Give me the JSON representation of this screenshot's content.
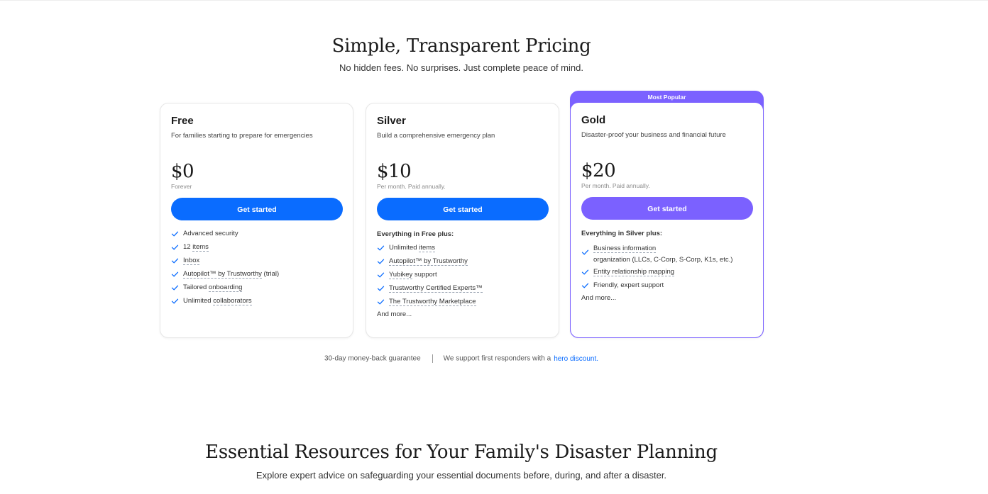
{
  "pricing": {
    "title": "Simple, Transparent Pricing",
    "subtitle": "No hidden fees. No surprises. Just complete peace of mind."
  },
  "plans": {
    "free": {
      "name": "Free",
      "description": "For families starting to prepare for emergencies",
      "price": "$0",
      "price_note": "Forever",
      "cta": "Get started",
      "features": [
        {
          "text": "Advanced security"
        },
        {
          "pre": "12 ",
          "link": "items"
        },
        {
          "link": "Inbox"
        },
        {
          "link": "Autopilot™ by Trustworthy",
          "post": " (trial)"
        },
        {
          "pre": "Tailored ",
          "link": "onboarding"
        },
        {
          "pre": "Unlimited ",
          "link": "collaborators"
        }
      ]
    },
    "silver": {
      "name": "Silver",
      "description": "Build a comprehensive emergency plan",
      "price": "$10",
      "price_note": "Per month. Paid annually.",
      "cta": "Get started",
      "features_head": "Everything in Free plus:",
      "features": [
        {
          "pre": "Unlimited ",
          "link": "items"
        },
        {
          "link": "Autopilot™ by Trustworthy"
        },
        {
          "link": "Yubikey",
          "post": " support"
        },
        {
          "link": "Trustworthy Certified Experts™"
        },
        {
          "link": "The Trustworthy Marketplace"
        }
      ],
      "and_more": "And more..."
    },
    "gold": {
      "badge": "Most Popular",
      "name": "Gold",
      "description": "Disaster-proof your business and financial future",
      "price": "$20",
      "price_note": "Per month. Paid annually.",
      "cta": "Get started",
      "features_head": "Everything in Silver plus:",
      "features": [
        {
          "link": "Business information",
          "line2": "organization (LLCs, C-Corp, S-Corp, K1s, etc.)"
        },
        {
          "link": "Entity relationship mapping"
        },
        {
          "text": "Friendly, expert support"
        }
      ],
      "and_more": "And more..."
    }
  },
  "footer": {
    "guarantee": "30-day money-back guarantee",
    "responders": "We support first responders with a",
    "hero_link": "hero discount."
  },
  "resources": {
    "title": "Essential Resources for Your Family's Disaster Planning",
    "subtitle": "Explore expert advice on safeguarding your essential documents before, during, and after a disaster."
  },
  "colors": {
    "accent_blue": "#0a6cff",
    "accent_purple": "#7b61ff"
  },
  "icons": {
    "feature": "check-icon"
  }
}
